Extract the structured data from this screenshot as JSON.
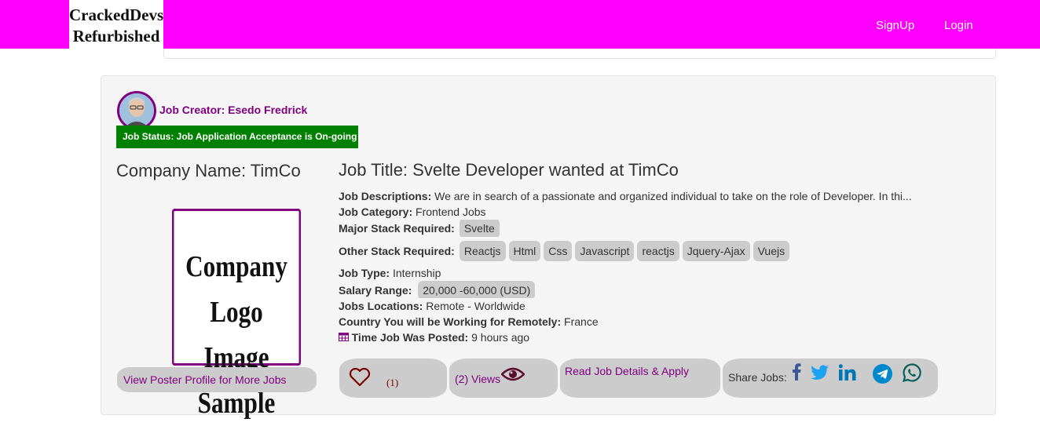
{
  "brand": {
    "line1": "CrackedDevs",
    "line2": "Refurbished"
  },
  "nav": {
    "signup": "SignUp",
    "login": "Login"
  },
  "job": {
    "creator": "Job Creator: Esedo Fredrick",
    "status": "Job Status: Job Application Acceptance is On-going",
    "company_name": "Company Name: TimCo",
    "logo_line1": "Company Logo",
    "logo_line2": "Image Sample",
    "profile_link": "View Poster Profile for More Jobs",
    "title": "Job Title: Svelte Developer wanted at TimCo",
    "descriptions_label": "Job Descriptions:",
    "descriptions_value": "We are in search of a passionate and organized individual to take on the role of Developer. In thi...",
    "category_label": "Job Category:",
    "category_value": "Frontend Jobs",
    "major_stack_label": "Major Stack Required:",
    "major_stack": [
      "Svelte"
    ],
    "other_stack_label": "Other Stack Required:",
    "other_stack": [
      "Reactjs",
      "Html",
      "Css",
      "Javascript",
      "reactjs",
      "Jquery-Ajax",
      "Vuejs"
    ],
    "type_label": "Job Type:",
    "type_value": "Internship",
    "salary_label": "Salary Range:",
    "salary_value": "20,000 -60,000 (USD)",
    "locations_label": "Jobs Locations:",
    "locations_value": "Remote - Worldwide",
    "country_label": "Country You will be Working for Remotely:",
    "country_value": "France",
    "posted_label": "Time Job Was Posted:",
    "posted_value": "9 hours ago",
    "likes": "(1)",
    "views": "(2) Views",
    "read_apply": "Read Job Details & Apply",
    "share_label": "Share Jobs:"
  },
  "colors": {
    "header": "#ff00ff",
    "accent": "#800080",
    "status": "#008000",
    "pill": "#cccccc",
    "facebook": "#3b5998",
    "twitter": "#1da1f2",
    "linkedin": "#0077b5",
    "telegram": "#0088cc",
    "whatsapp": "#075e54"
  }
}
